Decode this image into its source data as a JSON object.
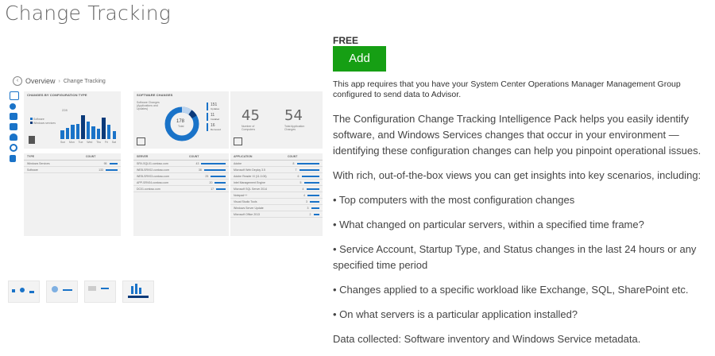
{
  "page": {
    "title": "Change Tracking"
  },
  "preview": {
    "nav": {
      "back_label": "Overview",
      "separator": "›",
      "current": "Change Tracking"
    },
    "tile1": {
      "title": "CHANGES BY CONFIGURATION TYPE",
      "total": "228",
      "legend": [
        "Software",
        "Windows services"
      ],
      "days": [
        "Sun",
        "Mon",
        "Tue",
        "Wed",
        "Thu",
        "Fri",
        "Sat"
      ],
      "bars": [
        0.35,
        0.45,
        0.55,
        0.6,
        0.95,
        0.7,
        0.5,
        0.4,
        0.85,
        0.55,
        0.3
      ],
      "table_head": [
        "TYPE",
        "COUNT"
      ],
      "rows": [
        {
          "name": "Windows Services",
          "count": "95",
          "bar": 0.35
        },
        {
          "name": "Software",
          "count": "133",
          "bar": 0.5
        }
      ]
    },
    "tile2": {
      "title": "SOFTWARE CHANGES",
      "caption": "Software Changes (Applications and Updates)",
      "donut_value": "178",
      "donut_label": "Total",
      "side_stats": [
        {
          "value": "151",
          "label": "Updates"
        },
        {
          "value": "11",
          "label": "Installed"
        },
        {
          "value": "16",
          "label": "Removed"
        }
      ],
      "table_head": [
        "SERVER",
        "COUNT"
      ],
      "rows": [
        {
          "name": "SRV-SQL01.contoso.com",
          "count": "43",
          "bar": 0.9
        },
        {
          "name": "WEB-SRV02.contoso.com",
          "count": "38",
          "bar": 0.8
        },
        {
          "name": "WEB-SRV03.contoso.com",
          "count": "25",
          "bar": 0.55
        },
        {
          "name": "APP-SRV04.contoso.com",
          "count": "20",
          "bar": 0.4
        },
        {
          "name": "DC01.contoso.com",
          "count": "17",
          "bar": 0.35
        }
      ]
    },
    "tile3": {
      "stat1_value": "45",
      "stat1_label": "Number of Computers",
      "stat2_value": "54",
      "stat2_label": "Total Application Changes",
      "table_head": [
        "APPLICATION",
        "COUNT"
      ],
      "rows": [
        {
          "name": "Adobe",
          "count": "8",
          "bar": 0.95
        },
        {
          "name": "Microsoft Web Deploy 3.5",
          "count": "7",
          "bar": 0.85
        },
        {
          "name": "Adobe Reader XI (11.0.06)",
          "count": "6",
          "bar": 0.75
        },
        {
          "name": "Intel Management Engine",
          "count": "5",
          "bar": 0.65
        },
        {
          "name": "Microsoft SQL Server 2014",
          "count": "4",
          "bar": 0.55
        },
        {
          "name": "Notepad++",
          "count": "4",
          "bar": 0.5
        },
        {
          "name": "Visual Studio Tools",
          "count": "3",
          "bar": 0.4
        },
        {
          "name": "Windows Server Update",
          "count": "3",
          "bar": 0.35
        },
        {
          "name": "Microsoft Office 2013",
          "count": "2",
          "bar": 0.25
        }
      ]
    }
  },
  "details": {
    "price": "FREE",
    "add_label": "Add",
    "requirement": "This app requires that you have your System Center Operations Manager Management Group configured to send data to Advisor.",
    "paragraphs": [
      "The Configuration Change Tracking Intelligence Pack helps you easily identify software, and Windows Services changes that occur in your environment — identifying these configuration changes can help you pinpoint operational issues.",
      "With rich, out-of-the-box views you can get insights into key scenarios, including:",
      "• Top computers with the most configuration changes",
      "• What changed on particular servers, within a specified time frame?",
      "• Service Account, Startup Type, and Status changes in the last 24 hours or any specified time period",
      "• Changes applied to a specific workload like Exchange, SQL, SharePoint etc.",
      "• On what servers is a particular application installed?",
      "Data collected: Software inventory and Windows Service metadata."
    ]
  },
  "colors": {
    "accent": "#1a73c8",
    "add_button": "#169f14",
    "title": "#666666"
  }
}
